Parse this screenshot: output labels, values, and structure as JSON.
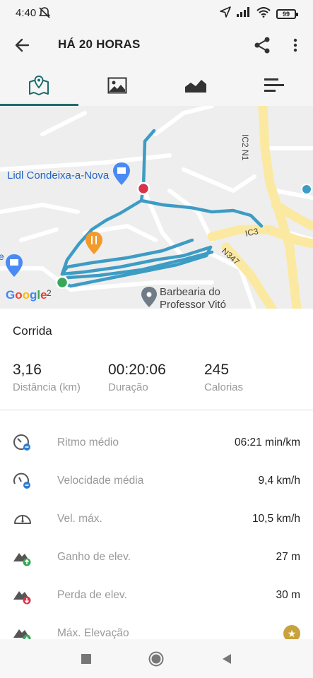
{
  "status_bar": {
    "time": "4:40",
    "battery": "99"
  },
  "header": {
    "title": "HÁ 20 HORAS"
  },
  "tabs": [
    {
      "name": "map-tab",
      "icon": "map-icon",
      "active": true
    },
    {
      "name": "photos-tab",
      "icon": "image-icon",
      "active": false
    },
    {
      "name": "chart-tab",
      "icon": "elevation-chart-icon",
      "active": false
    },
    {
      "name": "stats-tab",
      "icon": "list-bars-icon",
      "active": false
    }
  ],
  "map": {
    "labels": {
      "lidl": "Lidl Condeixa-a-Nova",
      "barbearia": "Barbearia do\nProfessor Vitó",
      "ic2": "IC2 N1",
      "ic3": "IC3",
      "n347": "N347",
      "edge_e": "e",
      "edge_2": "2"
    },
    "colors": {
      "track": "#3d9cc4",
      "start": "#3aa65a",
      "end": "#d9334a",
      "road": "#fbe9a2"
    }
  },
  "activity": {
    "type": "Corrida",
    "stats": [
      {
        "value": "3,16",
        "label": "Distância (km)"
      },
      {
        "value": "00:20:06",
        "label": "Duração"
      },
      {
        "value": "245",
        "label": "Calorias"
      }
    ]
  },
  "metrics": [
    {
      "icon": "pace-gauge-icon",
      "label": "Ritmo médio",
      "value": "06:21 min/km"
    },
    {
      "icon": "speed-gauge-icon",
      "label": "Velocidade média",
      "value": "9,4 km/h"
    },
    {
      "icon": "speedometer-icon",
      "label": "Vel. máx.",
      "value": "10,5 km/h"
    },
    {
      "icon": "elevation-gain-icon",
      "label": "Ganho de elev.",
      "value": "27 m"
    },
    {
      "icon": "elevation-loss-icon",
      "label": "Perda de elev.",
      "value": "30 m"
    },
    {
      "icon": "max-elevation-icon",
      "label": "Máx. Elevação",
      "value": "",
      "premium": true
    }
  ]
}
